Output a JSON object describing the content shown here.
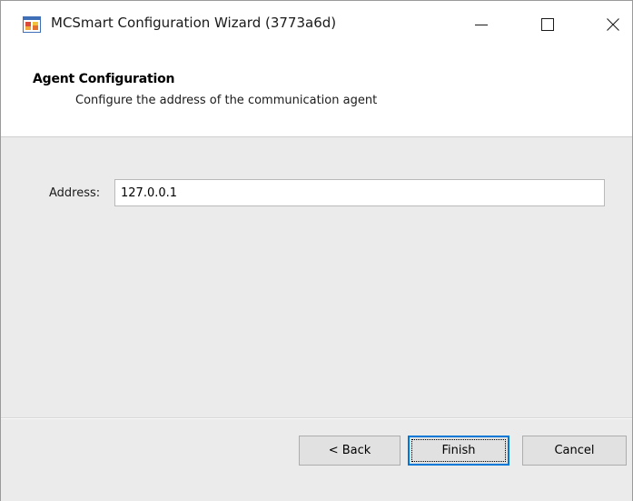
{
  "window": {
    "title": "MCSmart Configuration Wizard (3773a6d)",
    "icon": "app-window-icon"
  },
  "header": {
    "title": "Agent Configuration",
    "subtitle": "Configure the address of the communication agent"
  },
  "form": {
    "address_label": "Address:",
    "address_value": "127.0.0.1"
  },
  "buttons": {
    "back": "< Back",
    "finish": "Finish",
    "cancel": "Cancel"
  },
  "colors": {
    "body_bg": "#ebebeb",
    "button_bg": "#e1e1e1",
    "focus_accent": "#0078d7"
  }
}
